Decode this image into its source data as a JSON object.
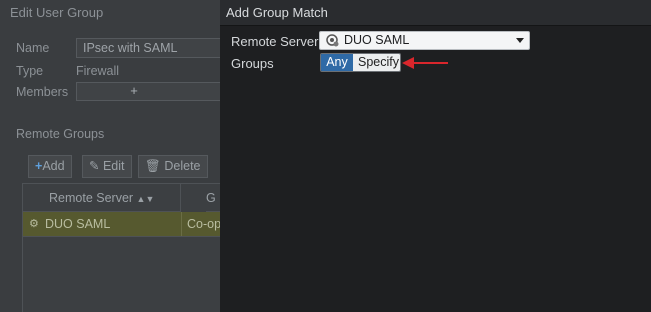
{
  "background_dialog": {
    "title": "Edit User Group",
    "name_label": "Name",
    "name_value": "IPsec with SAML",
    "type_label": "Type",
    "type_value": "Firewall",
    "members_label": "Members",
    "members_add": "+",
    "remote_groups_title": "Remote Groups",
    "toolbar": {
      "add": "Add",
      "edit": "Edit",
      "delete": "Delete"
    },
    "table": {
      "headers": [
        "Remote Server",
        "G"
      ],
      "rows": [
        {
          "server": "DUO SAML",
          "group": "Co-op"
        }
      ]
    }
  },
  "add_group_match": {
    "title": "Add Group Match",
    "remote_server_label": "Remote Server",
    "remote_server_value": "DUO SAML",
    "groups_label": "Groups",
    "groups_options": [
      "Any",
      "Specify"
    ],
    "groups_selected": "Any",
    "arrow_color": "#d9262c",
    "selected_color": "#2f6aa6"
  }
}
